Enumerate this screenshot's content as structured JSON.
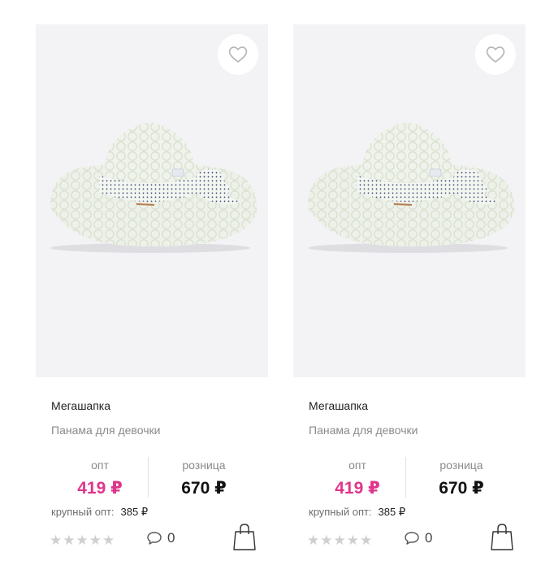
{
  "products": [
    {
      "brand": "Мегашапка",
      "name": "Панама для девочки",
      "opt_label": "опт",
      "opt_price": "419 ₽",
      "retail_label": "розница",
      "retail_price": "670 ₽",
      "bulk_label": "крупный опт:",
      "bulk_price": "385 ₽",
      "rating": 0,
      "rating_max": 5,
      "comments_count": "0",
      "favorite": false
    },
    {
      "brand": "Мегашапка",
      "name": "Панама для девочки",
      "opt_label": "опт",
      "opt_price": "419 ₽",
      "retail_label": "розница",
      "retail_price": "670 ₽",
      "bulk_label": "крупный опт:",
      "bulk_price": "385 ₽",
      "rating": 0,
      "rating_max": 5,
      "comments_count": "0",
      "favorite": false
    }
  ],
  "icons": {
    "favorite": "heart-outline-icon",
    "comments": "speech-bubble-icon",
    "cart": "shopping-bag-icon",
    "star": "star-icon"
  },
  "colors": {
    "accent_price": "#e0348c",
    "image_background": "#f3f3f5",
    "star_inactive": "#cfcfcf"
  }
}
